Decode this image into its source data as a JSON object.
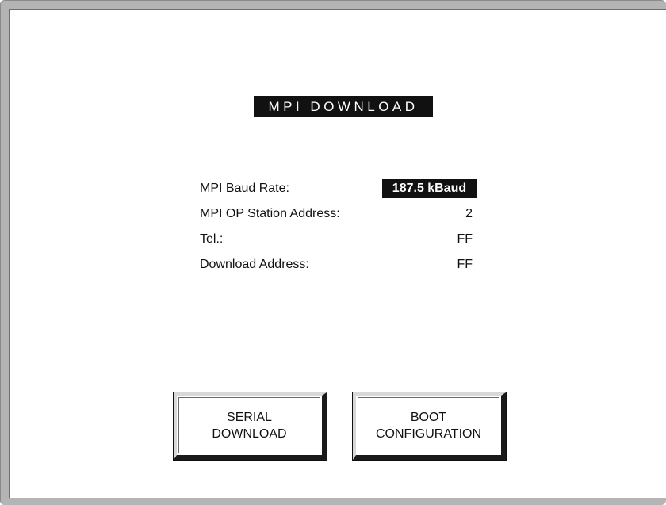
{
  "screen": {
    "title": "MPI DOWNLOAD"
  },
  "settings": [
    {
      "label": "MPI Baud Rate:",
      "value": "187.5 kBaud"
    },
    {
      "label": "MPI OP Station Address:",
      "value": "2"
    },
    {
      "label": "Tel.:",
      "value": "FF"
    },
    {
      "label": "Download Address:",
      "value": "FF"
    }
  ],
  "buttons": {
    "serial_download": {
      "line1": "SERIAL",
      "line2": "DOWNLOAD"
    },
    "boot_configuration": {
      "line1": "BOOT",
      "line2": "CONFIGURATION"
    }
  }
}
